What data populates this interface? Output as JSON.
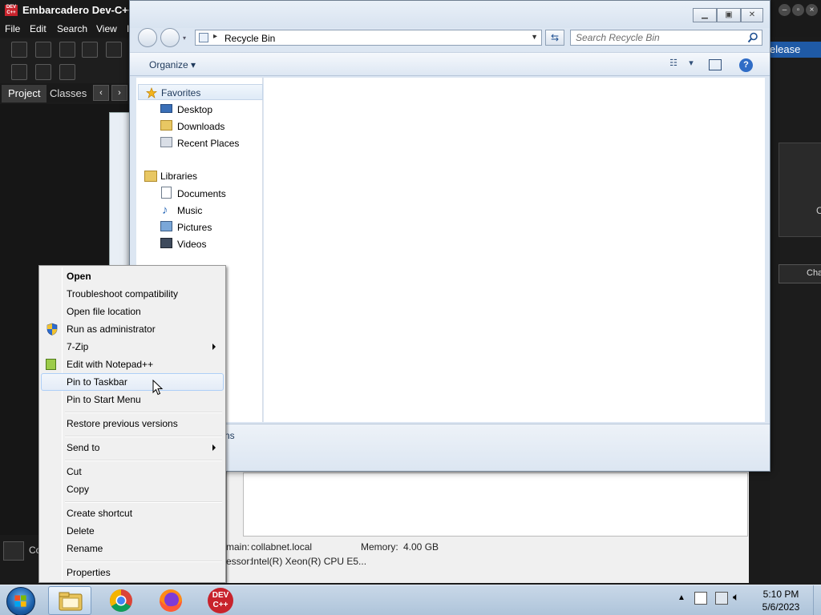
{
  "ide": {
    "title": "Embarcadero Dev-C++",
    "logo_text": "DEV C++",
    "menu": [
      "File",
      "Edit",
      "Search",
      "View",
      "I"
    ],
    "tabs": [
      "Project",
      "Classes"
    ],
    "right_strip_label": "elease",
    "right_box_letter": "C",
    "right_button_label": "Cha",
    "bottom_label": "Co"
  },
  "sysinfo": {
    "domain_label": "main:",
    "domain_value": "collabnet.local",
    "memory_label": "Memory:",
    "memory_value": "4.00 GB",
    "processor_label": "essor:",
    "processor_value": "Intel(R) Xeon(R) CPU E5..."
  },
  "explorer": {
    "address_path": "Recycle Bin",
    "search_placeholder": "Search Recycle Bin",
    "organize_label": "Organize",
    "details_partial": "ns",
    "nav": {
      "favorites_header": "Favorites",
      "favorites": [
        "Desktop",
        "Downloads",
        "Recent Places"
      ],
      "libraries_header": "Libraries",
      "libraries": [
        "Documents",
        "Music",
        "Pictures",
        "Videos"
      ]
    }
  },
  "context_menu": {
    "items": [
      {
        "label": "Open",
        "bold": true
      },
      {
        "label": "Troubleshoot compatibility"
      },
      {
        "label": "Open file location"
      },
      {
        "label": "Run as administrator",
        "icon": "uac-shield-icon"
      },
      {
        "label": "7-Zip",
        "submenu": true
      },
      {
        "label": "Edit with Notepad++",
        "icon": "notepad-plus-plus-icon"
      },
      {
        "label": "Pin to Taskbar",
        "hover": true
      },
      {
        "label": "Pin to Start Menu"
      },
      {
        "label": "Restore previous versions"
      },
      {
        "label": "Send to",
        "submenu": true
      },
      {
        "label": "Cut"
      },
      {
        "label": "Copy"
      },
      {
        "label": "Create shortcut"
      },
      {
        "label": "Delete"
      },
      {
        "label": "Rename"
      },
      {
        "label": "Properties"
      }
    ]
  },
  "taskbar": {
    "apps": [
      "windows-explorer-icon",
      "chrome-icon",
      "firefox-icon",
      "dev-cpp-icon"
    ],
    "devcpp_text": "DEV C++",
    "clock_time": "5:10 PM",
    "clock_date": "5/6/2023"
  },
  "colors": {
    "ide_bg": "#1b1b1b",
    "explorer_frame": "#dce6f2",
    "menu_bg": "#f0f0f0",
    "hover_border": "#aecff7",
    "taskbar": "#b9cde2"
  }
}
